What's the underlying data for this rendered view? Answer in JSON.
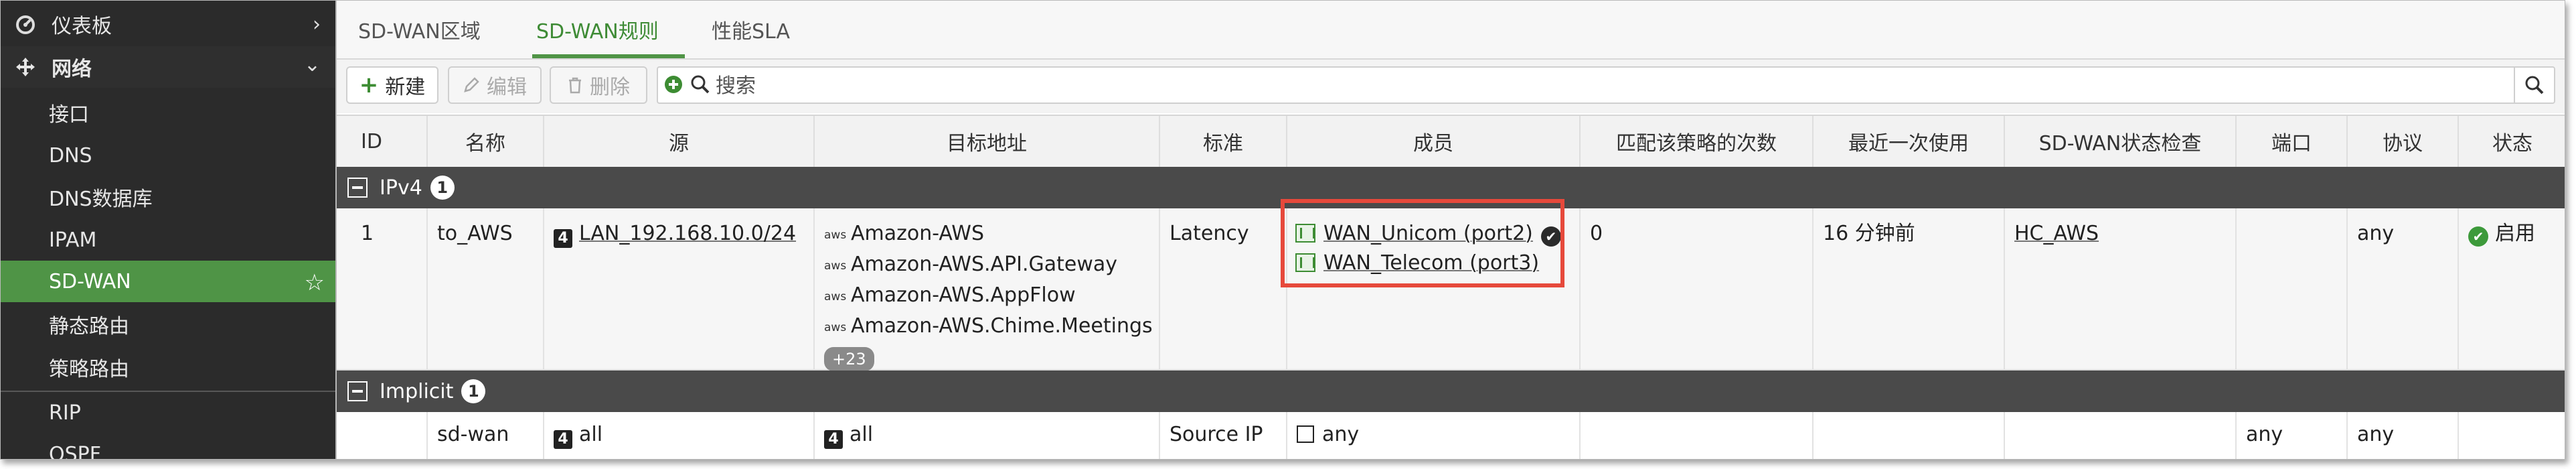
{
  "sidebar": {
    "items": [
      {
        "label": "仪表板",
        "icon": "dashboard-icon"
      },
      {
        "label": "网络",
        "icon": "network-move-icon"
      },
      {
        "label": "接口"
      },
      {
        "label": "DNS"
      },
      {
        "label": "DNS数据库"
      },
      {
        "label": "IPAM"
      },
      {
        "label": "SD-WAN"
      },
      {
        "label": "静态路由"
      },
      {
        "label": "策略路由"
      },
      {
        "label": "RIP"
      },
      {
        "label": "OSPF"
      }
    ]
  },
  "tabs": [
    "SD-WAN区域",
    "SD-WAN规则",
    "性能SLA"
  ],
  "toolbar": {
    "new_label": "新建",
    "edit_label": "编辑",
    "delete_label": "删除",
    "search_placeholder": "搜索"
  },
  "columns": [
    "ID",
    "名称",
    "源",
    "目标地址",
    "标准",
    "成员",
    "匹配该策略的次数",
    "最近一次使用",
    "SD-WAN状态检查",
    "端口",
    "协议",
    "状态"
  ],
  "groups": [
    {
      "label": "IPv4",
      "count": "1",
      "rows": [
        {
          "id": "1",
          "name": "to_AWS",
          "source": "LAN_192.168.10.0/24",
          "destinations": [
            "Amazon-AWS",
            "Amazon-AWS.API.Gateway",
            "Amazon-AWS.AppFlow",
            "Amazon-AWS.Chime.Meetings"
          ],
          "destinations_more": "+23",
          "aws_tag": "aws",
          "criteria": "Latency",
          "members": [
            "WAN_Unicom (port2)",
            "WAN_Telecom (port3)"
          ],
          "hit_count": "0",
          "last_used": "16 分钟前",
          "health_check": "HC_AWS",
          "port": "",
          "protocol": "any",
          "status": "启用"
        }
      ]
    },
    {
      "label": "Implicit",
      "count": "1",
      "rows": [
        {
          "id": "",
          "name": "sd-wan",
          "source": "all",
          "destination": "all",
          "criteria": "Source IP",
          "members": "any",
          "port": "any",
          "protocol": "any"
        }
      ]
    }
  ],
  "colors": {
    "accent_green": "#4f9446",
    "highlight_red": "#e6493b",
    "group_header": "#4a4a4a",
    "sidebar_bg": "#2b2b2b"
  }
}
